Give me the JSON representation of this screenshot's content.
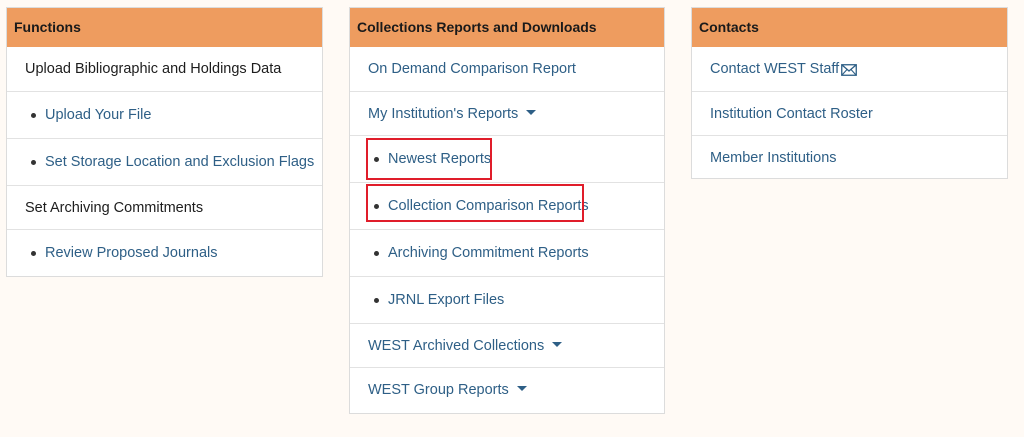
{
  "functions": {
    "title": "Functions",
    "upload_heading": "Upload Bibliographic and Holdings Data",
    "upload_file": "Upload Your File",
    "storage_flags": "Set Storage Location and Exclusion Flags",
    "archiving_heading": "Set Archiving Commitments",
    "review_journals": "Review Proposed Journals"
  },
  "collections": {
    "title": "Collections Reports and Downloads",
    "on_demand": "On Demand Comparison Report",
    "my_institution": "My Institution's Reports",
    "newest": "Newest Reports",
    "collection_comparison": "Collection Comparison Reports",
    "archiving_commitment": "Archiving Commitment Reports",
    "jrnl_export": "JRNL Export Files",
    "west_archived": "WEST Archived Collections",
    "west_group": "WEST Group Reports"
  },
  "contacts": {
    "title": "Contacts",
    "contact_staff": "Contact WEST Staff",
    "contact_staff_icon": "envelope-icon",
    "roster": "Institution Contact Roster",
    "members": "Member Institutions"
  },
  "colors": {
    "header_bg": "#ee9c5f",
    "link": "#2e5f86",
    "highlight": "#e01d2a",
    "page_bg": "#fffaf5"
  }
}
